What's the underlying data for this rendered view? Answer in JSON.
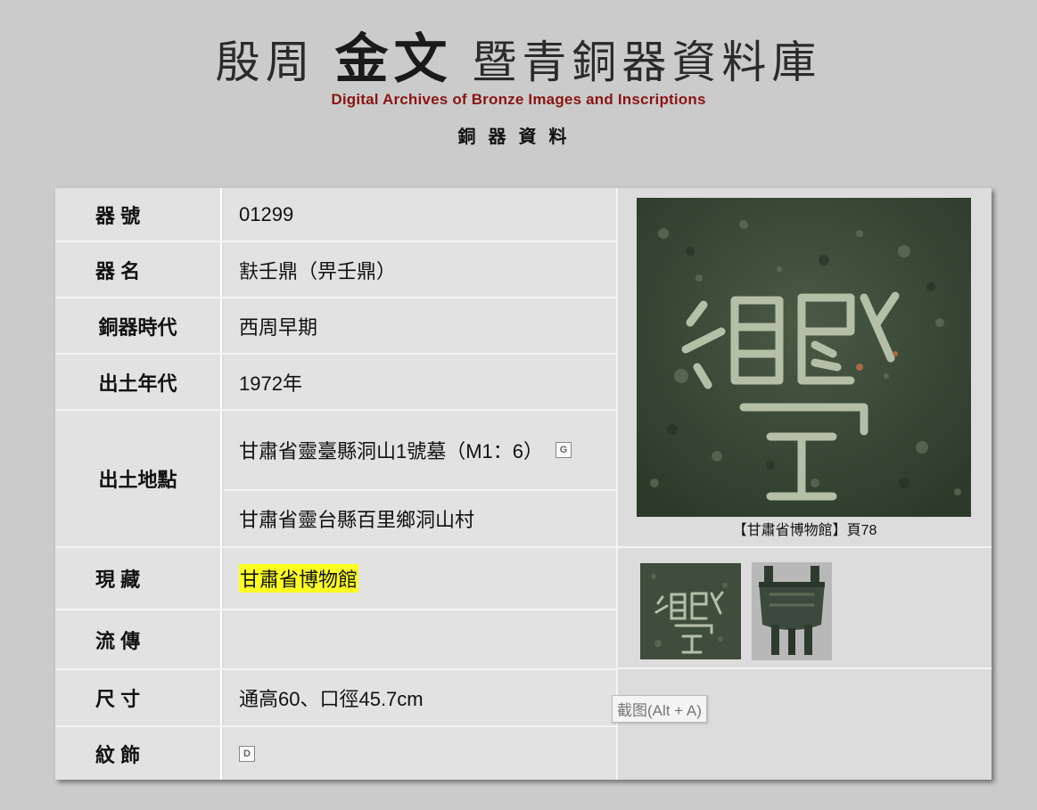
{
  "banner": {
    "title_left": "殷周",
    "title_glyphs": "金文",
    "title_right": "暨青銅器資料庫",
    "title_en": "Digital Archives of Bronze Images and Inscriptions",
    "subtitle": "銅器資料"
  },
  "fields": {
    "id": {
      "label": "器 號",
      "value": "01299"
    },
    "name": {
      "label": "器 名",
      "value": "㝬壬鼎（畀壬鼎）"
    },
    "era": {
      "label": "銅器時代",
      "value": "西周早期"
    },
    "excavation_year": {
      "label": "出土年代",
      "value": "1972年"
    },
    "excavation_site": {
      "label": "出土地點",
      "value_1": "甘肅省靈臺縣洞山1號墓（M1：6）",
      "value_2": "甘肅省靈台縣百里鄉洞山村"
    },
    "collection": {
      "label": "現 藏",
      "value": "甘肅省博物館"
    },
    "provenance": {
      "label": "流 傳",
      "value": ""
    },
    "dimensions": {
      "label": "尺 寸",
      "value": "通高60、口徑45.7cm"
    },
    "decoration": {
      "label": "紋 飾"
    }
  },
  "icons": {
    "site_icon_glyph": "G",
    "decoration_icon_glyph": "D"
  },
  "image_panel": {
    "caption": "【甘肅省博物館】頁78"
  },
  "tooltip": {
    "text": "截图(Alt + A)"
  }
}
